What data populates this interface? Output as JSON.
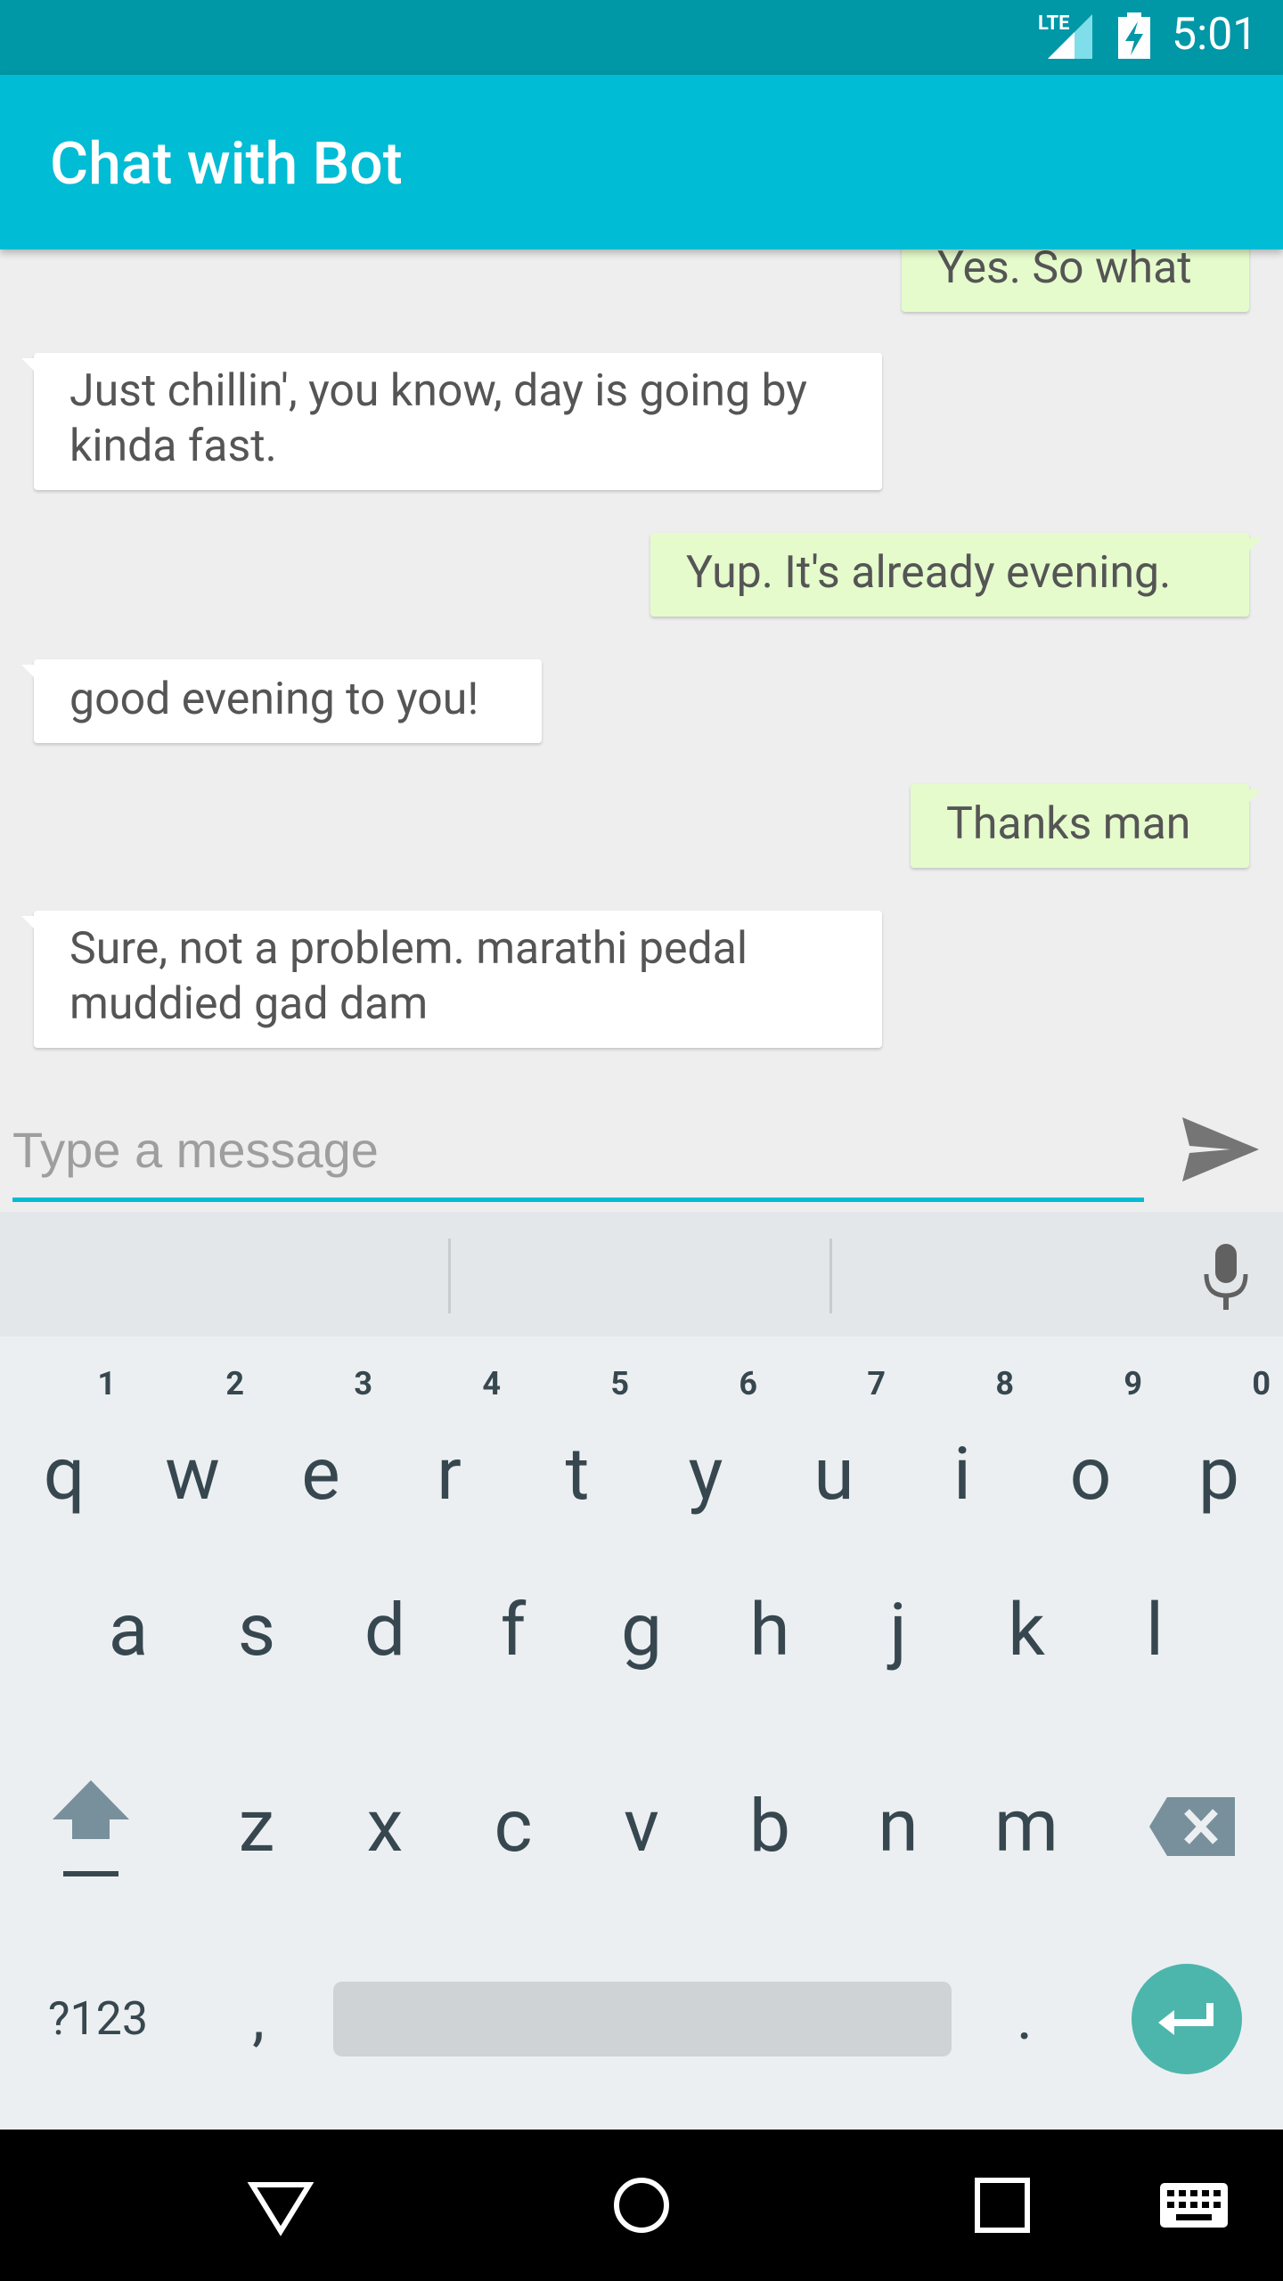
{
  "status_bar": {
    "network": "LTE",
    "time": "5:01"
  },
  "app_bar": {
    "title": "Chat with Bot"
  },
  "messages": [
    {
      "sender": "me",
      "text": "Yes. So what"
    },
    {
      "sender": "bot",
      "text": "Just chillin', you know, day is going by kinda fast."
    },
    {
      "sender": "me",
      "text": "Yup. It's already evening."
    },
    {
      "sender": "bot",
      "text": "good evening to you!"
    },
    {
      "sender": "me",
      "text": "Thanks man"
    },
    {
      "sender": "bot",
      "text": "Sure, not a problem. marathi pedal muddied gad dam"
    }
  ],
  "composer": {
    "placeholder": "Type a message",
    "value": ""
  },
  "keyboard": {
    "row1": [
      {
        "key": "q",
        "hint": "1"
      },
      {
        "key": "w",
        "hint": "2"
      },
      {
        "key": "e",
        "hint": "3"
      },
      {
        "key": "r",
        "hint": "4"
      },
      {
        "key": "t",
        "hint": "5"
      },
      {
        "key": "y",
        "hint": "6"
      },
      {
        "key": "u",
        "hint": "7"
      },
      {
        "key": "i",
        "hint": "8"
      },
      {
        "key": "o",
        "hint": "9"
      },
      {
        "key": "p",
        "hint": "0"
      }
    ],
    "row2": [
      "a",
      "s",
      "d",
      "f",
      "g",
      "h",
      "j",
      "k",
      "l"
    ],
    "row3": [
      "z",
      "x",
      "c",
      "v",
      "b",
      "n",
      "m"
    ],
    "symbols_label": "?123",
    "comma": ",",
    "period": "."
  },
  "colors": {
    "status_bar": "#0097a7",
    "app_bar": "#00bcd4",
    "my_bubble": "#e5fbcc",
    "bot_bubble": "#ffffff",
    "enter_key": "#4db6ac"
  }
}
